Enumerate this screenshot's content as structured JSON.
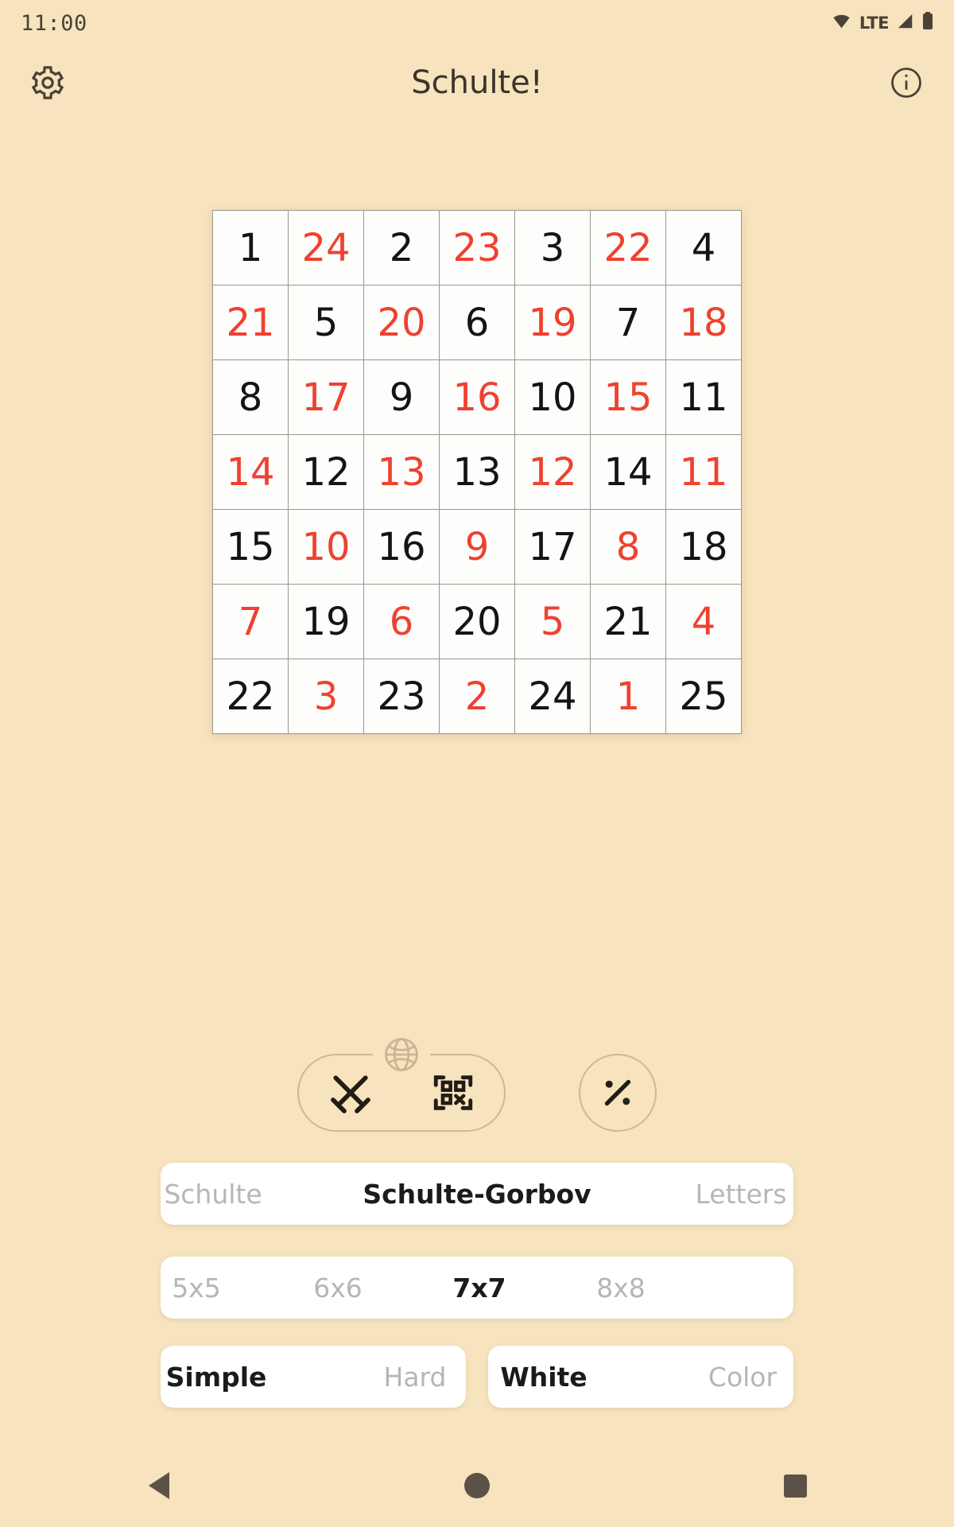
{
  "status_bar": {
    "time": "11:00",
    "network_label": "LTE",
    "icons": [
      "wifi-icon",
      "signal-icon",
      "battery-icon"
    ]
  },
  "app_bar": {
    "title": "Schulte!",
    "left_icon": "settings-gear-icon",
    "right_icon": "info-icon"
  },
  "board": {
    "rows": 7,
    "cols": 7,
    "black_color": "#141414",
    "red_color": "#ef4130",
    "cells": [
      [
        {
          "v": "1",
          "c": "black"
        },
        {
          "v": "24",
          "c": "red"
        },
        {
          "v": "2",
          "c": "black"
        },
        {
          "v": "23",
          "c": "red"
        },
        {
          "v": "3",
          "c": "black"
        },
        {
          "v": "22",
          "c": "red"
        },
        {
          "v": "4",
          "c": "black"
        }
      ],
      [
        {
          "v": "21",
          "c": "red"
        },
        {
          "v": "5",
          "c": "black"
        },
        {
          "v": "20",
          "c": "red"
        },
        {
          "v": "6",
          "c": "black"
        },
        {
          "v": "19",
          "c": "red"
        },
        {
          "v": "7",
          "c": "black"
        },
        {
          "v": "18",
          "c": "red"
        }
      ],
      [
        {
          "v": "8",
          "c": "black"
        },
        {
          "v": "17",
          "c": "red"
        },
        {
          "v": "9",
          "c": "black"
        },
        {
          "v": "16",
          "c": "red"
        },
        {
          "v": "10",
          "c": "black"
        },
        {
          "v": "15",
          "c": "red"
        },
        {
          "v": "11",
          "c": "black"
        }
      ],
      [
        {
          "v": "14",
          "c": "red"
        },
        {
          "v": "12",
          "c": "black"
        },
        {
          "v": "13",
          "c": "red"
        },
        {
          "v": "13",
          "c": "black"
        },
        {
          "v": "12",
          "c": "red"
        },
        {
          "v": "14",
          "c": "black"
        },
        {
          "v": "11",
          "c": "red"
        }
      ],
      [
        {
          "v": "15",
          "c": "black"
        },
        {
          "v": "10",
          "c": "red"
        },
        {
          "v": "16",
          "c": "black"
        },
        {
          "v": "9",
          "c": "red"
        },
        {
          "v": "17",
          "c": "black"
        },
        {
          "v": "8",
          "c": "red"
        },
        {
          "v": "18",
          "c": "black"
        }
      ],
      [
        {
          "v": "7",
          "c": "red"
        },
        {
          "v": "19",
          "c": "black"
        },
        {
          "v": "6",
          "c": "red"
        },
        {
          "v": "20",
          "c": "black"
        },
        {
          "v": "5",
          "c": "red"
        },
        {
          "v": "21",
          "c": "black"
        },
        {
          "v": "4",
          "c": "red"
        }
      ],
      [
        {
          "v": "22",
          "c": "black"
        },
        {
          "v": "3",
          "c": "red"
        },
        {
          "v": "23",
          "c": "black"
        },
        {
          "v": "2",
          "c": "red"
        },
        {
          "v": "24",
          "c": "black"
        },
        {
          "v": "1",
          "c": "red"
        },
        {
          "v": "25",
          "c": "black"
        }
      ]
    ]
  },
  "toolbar": {
    "globe_icon": "globe-icon",
    "swords_icon": "crossed-swords-icon",
    "qr_icon": "qr-code-icon",
    "percent_icon": "percent-icon"
  },
  "mode_selector": {
    "options": [
      "Schulte",
      "Schulte-Gorbov",
      "Letters"
    ],
    "selected": "Schulte-Gorbov"
  },
  "size_selector": {
    "options": [
      "5x5",
      "6x6",
      "7x7",
      "8x8"
    ],
    "selected": "7x7"
  },
  "style_selector": {
    "options": [
      "Simple",
      "Hard"
    ],
    "selected": "Simple"
  },
  "color_selector": {
    "options": [
      "White",
      "Color"
    ],
    "selected": "White"
  },
  "nav_bar": {
    "back": "back-triangle-icon",
    "home": "home-circle-icon",
    "recents": "recents-square-icon"
  },
  "theme": {
    "background": "#f7e3bd",
    "accent": "#cbb896",
    "text": "#3a332b"
  }
}
